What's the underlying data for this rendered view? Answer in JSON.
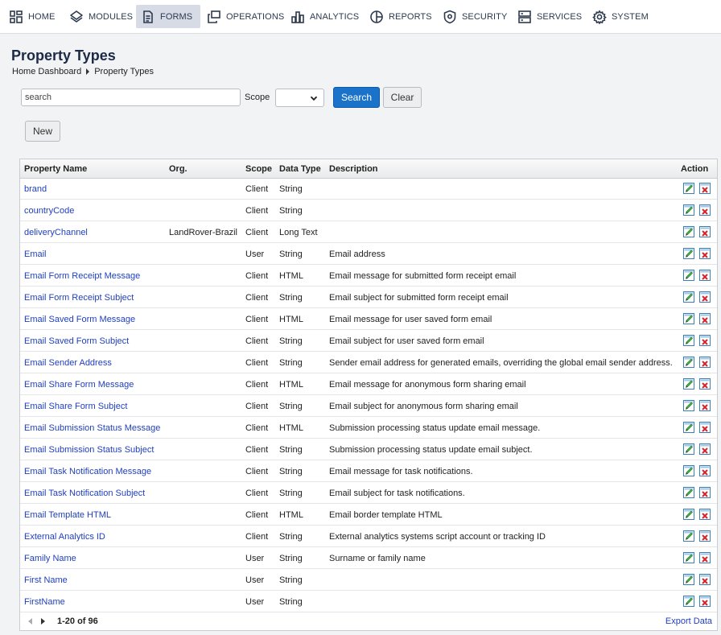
{
  "nav": [
    {
      "label": "HOME",
      "icon": "dashboard-icon"
    },
    {
      "label": "MODULES",
      "icon": "layers-icon"
    },
    {
      "label": "FORMS",
      "icon": "form-document-icon"
    },
    {
      "label": "OPERATIONS",
      "icon": "copy-windows-icon"
    },
    {
      "label": "ANALYTICS",
      "icon": "bar-chart-icon"
    },
    {
      "label": "REPORTS",
      "icon": "pie-chart-icon"
    },
    {
      "label": "SECURITY",
      "icon": "shield-icon"
    },
    {
      "label": "SERVICES",
      "icon": "server-icon"
    },
    {
      "label": "SYSTEM",
      "icon": "gear-icon"
    }
  ],
  "page": {
    "title": "Property Types",
    "breadcrumb": [
      "Home Dashboard",
      "Property Types"
    ]
  },
  "toolbar": {
    "search_placeholder": "search",
    "scope_label": "Scope",
    "scope_value": "",
    "search_label": "Search",
    "clear_label": "Clear",
    "new_label": "New"
  },
  "table": {
    "headers": {
      "name": "Property Name",
      "org": "Org.",
      "scope": "Scope",
      "type": "Data Type",
      "desc": "Description",
      "action": "Action"
    },
    "rows": [
      {
        "name": "brand",
        "org": "",
        "scope": "Client",
        "type": "String",
        "desc": ""
      },
      {
        "name": "countryCode",
        "org": "",
        "scope": "Client",
        "type": "String",
        "desc": ""
      },
      {
        "name": "deliveryChannel",
        "org": "LandRover-Brazil",
        "scope": "Client",
        "type": "Long Text",
        "desc": ""
      },
      {
        "name": "Email",
        "org": "",
        "scope": "User",
        "type": "String",
        "desc": "Email address"
      },
      {
        "name": "Email Form Receipt Message",
        "org": "",
        "scope": "Client",
        "type": "HTML",
        "desc": "Email message for submitted form receipt email"
      },
      {
        "name": "Email Form Receipt Subject",
        "org": "",
        "scope": "Client",
        "type": "String",
        "desc": "Email subject for submitted form receipt email"
      },
      {
        "name": "Email Saved Form Message",
        "org": "",
        "scope": "Client",
        "type": "HTML",
        "desc": "Email message for user saved form email"
      },
      {
        "name": "Email Saved Form Subject",
        "org": "",
        "scope": "Client",
        "type": "String",
        "desc": "Email subject for user saved form email"
      },
      {
        "name": "Email Sender Address",
        "org": "",
        "scope": "Client",
        "type": "String",
        "desc": "Sender email address for generated emails, overriding the global email sender address."
      },
      {
        "name": "Email Share Form Message",
        "org": "",
        "scope": "Client",
        "type": "HTML",
        "desc": "Email message for anonymous form sharing email"
      },
      {
        "name": "Email Share Form Subject",
        "org": "",
        "scope": "Client",
        "type": "String",
        "desc": "Email subject for anonymous form sharing email"
      },
      {
        "name": "Email Submission Status Message",
        "org": "",
        "scope": "Client",
        "type": "HTML",
        "desc": "Submission processing status update email message."
      },
      {
        "name": "Email Submission Status Subject",
        "org": "",
        "scope": "Client",
        "type": "String",
        "desc": "Submission processing status update email subject."
      },
      {
        "name": "Email Task Notification Message",
        "org": "",
        "scope": "Client",
        "type": "String",
        "desc": "Email message for task notifications."
      },
      {
        "name": "Email Task Notification Subject",
        "org": "",
        "scope": "Client",
        "type": "String",
        "desc": "Email subject for task notifications."
      },
      {
        "name": "Email Template HTML",
        "org": "",
        "scope": "Client",
        "type": "HTML",
        "desc": "Email border template HTML"
      },
      {
        "name": "External Analytics ID",
        "org": "",
        "scope": "Client",
        "type": "String",
        "desc": "External analytics systems script account or tracking ID"
      },
      {
        "name": "Family Name",
        "org": "",
        "scope": "User",
        "type": "String",
        "desc": "Surname or family name"
      },
      {
        "name": "First Name",
        "org": "",
        "scope": "User",
        "type": "String",
        "desc": ""
      },
      {
        "name": "FirstName",
        "org": "",
        "scope": "User",
        "type": "String",
        "desc": ""
      }
    ]
  },
  "footer": {
    "pager_text": "1-20 of 96",
    "export_label": "Export Data"
  }
}
